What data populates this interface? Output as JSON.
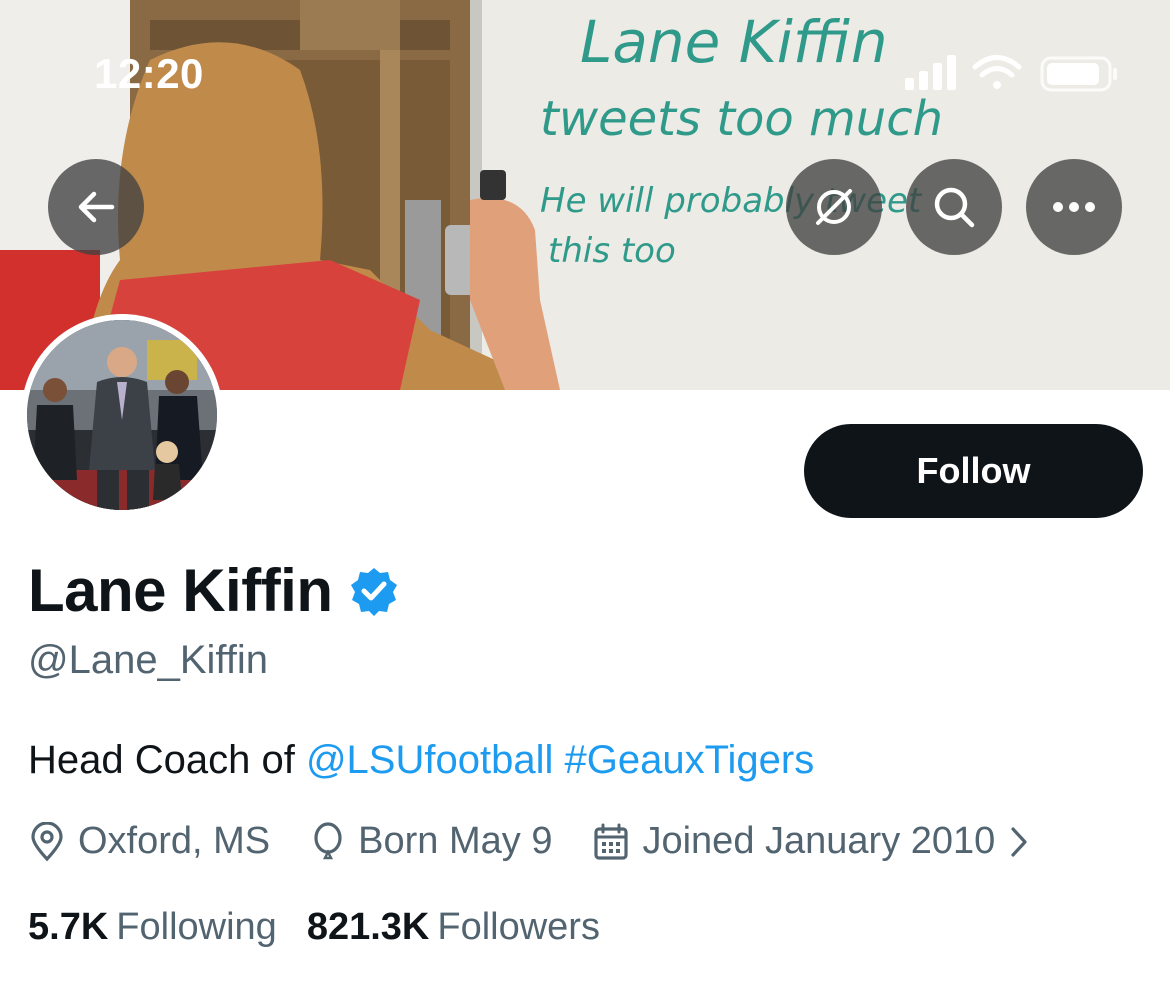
{
  "status_bar": {
    "time": "12:20"
  },
  "banner": {
    "whiteboard_lines": [
      "Lane Kiffin",
      "tweets too much",
      "He will probably tweet",
      "this too"
    ]
  },
  "banner_actions": {
    "back_icon": "arrow-left-icon",
    "hide_icon": "eye-slash-icon",
    "search_icon": "search-icon",
    "more_icon": "ellipsis-icon"
  },
  "profile": {
    "display_name": "Lane Kiffin",
    "handle": "@Lane_Kiffin",
    "verified": true,
    "verified_color": "#1d9bf0",
    "bio": {
      "prefix": "Head Coach of ",
      "mention": "@LSUfootball",
      "space": " ",
      "hashtag": "#GeauxTigers"
    },
    "location": "Oxford, MS",
    "born": "Born May 9",
    "joined": "Joined January 2010",
    "following_count": "5.7K",
    "following_label": "Following",
    "followers_count": "821.3K",
    "followers_label": "Followers"
  },
  "follow_button": {
    "label": "Follow"
  },
  "colors": {
    "accent": "#1d9bf0",
    "text": "#0f1419",
    "secondary": "#536471",
    "button": "#0f1419"
  }
}
